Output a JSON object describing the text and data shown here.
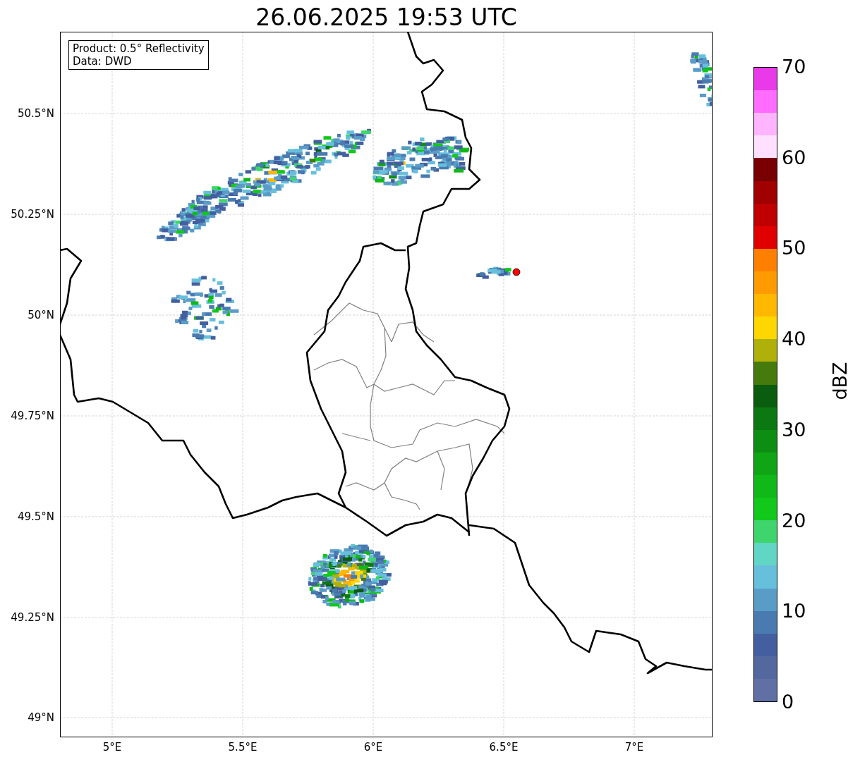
{
  "title": "26.06.2025 19:53 UTC",
  "info_box": [
    "Product: 0.5° Reflectivity",
    "Data: DWD"
  ],
  "x_ticks": [
    "5°E",
    "5.5°E",
    "6°E",
    "6.5°E",
    "7°E"
  ],
  "y_ticks": [
    "50.5°N",
    "50.25°N",
    "50°N",
    "49.75°N",
    "49.5°N",
    "49.25°N",
    "49°N"
  ],
  "colorbar": {
    "label": "dBZ",
    "ticks": [
      "70",
      "60",
      "50",
      "40",
      "30",
      "20",
      "10",
      "0"
    ],
    "bins": [
      {
        "color": "#6070a4"
      },
      {
        "color": "#52689f"
      },
      {
        "color": "#435fa0"
      },
      {
        "color": "#4a7bb0"
      },
      {
        "color": "#5a9cc8"
      },
      {
        "color": "#66c0dc"
      },
      {
        "color": "#62d6c4"
      },
      {
        "color": "#3ed66c"
      },
      {
        "color": "#12c81a"
      },
      {
        "color": "#10b818"
      },
      {
        "color": "#0fa514"
      },
      {
        "color": "#0d8e12"
      },
      {
        "color": "#0b7812"
      },
      {
        "color": "#0a5c0e"
      },
      {
        "color": "#457a0c"
      },
      {
        "color": "#b0b00a"
      },
      {
        "color": "#ffd700"
      },
      {
        "color": "#ffb800"
      },
      {
        "color": "#ff9b00"
      },
      {
        "color": "#ff8000"
      },
      {
        "color": "#e00000"
      },
      {
        "color": "#c00000"
      },
      {
        "color": "#a00000"
      },
      {
        "color": "#780000"
      },
      {
        "color": "#ffe0ff"
      },
      {
        "color": "#ffb4ff"
      },
      {
        "color": "#ff6cff"
      },
      {
        "color": "#e83ae8"
      }
    ]
  }
}
